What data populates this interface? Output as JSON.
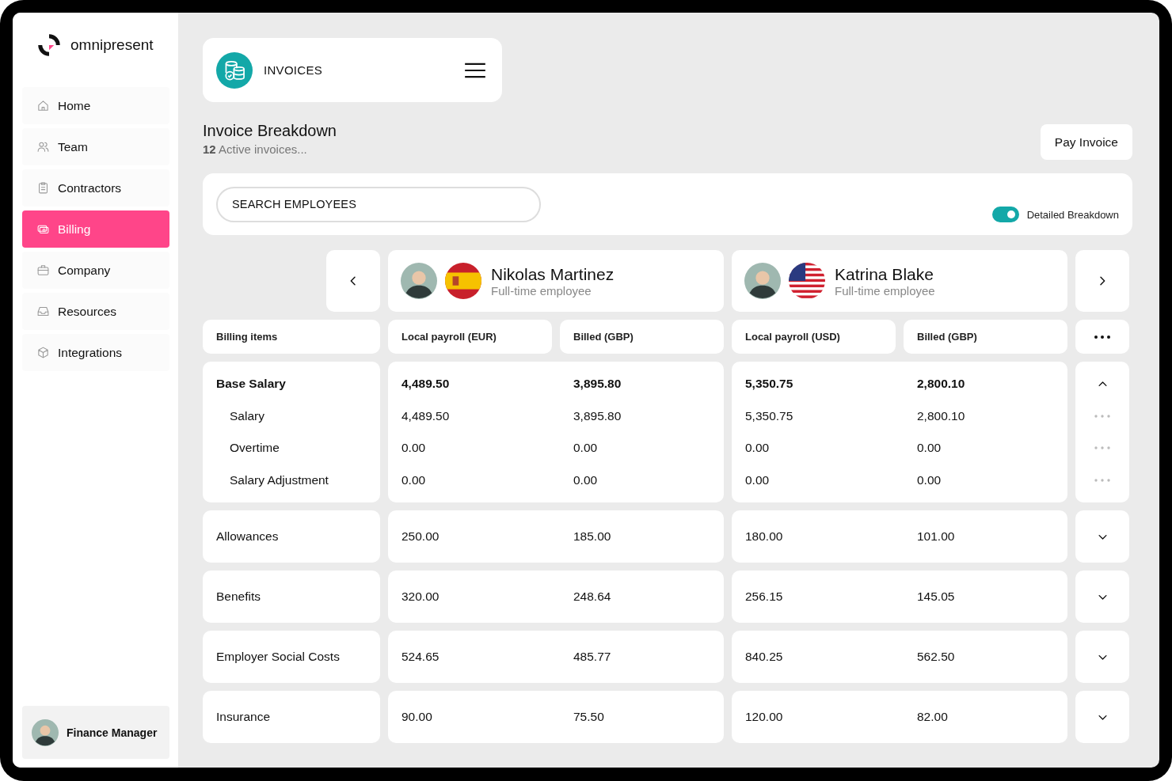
{
  "brand": {
    "name": "omnipresent"
  },
  "nav": {
    "items": [
      {
        "label": "Home",
        "selected": false
      },
      {
        "label": "Team",
        "selected": false
      },
      {
        "label": "Contractors",
        "selected": false
      },
      {
        "label": "Billing",
        "selected": true
      },
      {
        "label": "Company",
        "selected": false
      },
      {
        "label": "Resources",
        "selected": false
      },
      {
        "label": "Integrations",
        "selected": false
      }
    ]
  },
  "user": {
    "role": "Finance Manager"
  },
  "header": {
    "title": "INVOICES"
  },
  "page": {
    "title": "Invoice Breakdown",
    "subtitle": "**12** Active invoices..."
  },
  "pay_button": "Pay Invoice",
  "search": {
    "placeholder": "SEARCH EMPLOYEES"
  },
  "toggle": {
    "label": "Detailed Breakdown",
    "on": true
  },
  "employees": [
    {
      "name": "Nikolas Martinez",
      "type": "Full-time employee"
    },
    {
      "name": "Katrina Blake",
      "type": "Full-time employee"
    }
  ],
  "columns": [
    "Billing items",
    "Local payroll (EUR)",
    "Billed (GBP)",
    "Local payroll (USD)",
    "Billed (GBP)"
  ],
  "groups": [
    {
      "label": "Base Salary",
      "values": [
        "4,489.50",
        "3,895.80",
        "5,350.75",
        "2,800.10"
      ],
      "expanded": true,
      "children": [
        {
          "label": "Salary",
          "values": [
            "4,489.50",
            "3,895.80",
            "5,350.75",
            "2,800.10"
          ]
        },
        {
          "label": "Overtime",
          "values": [
            "0.00",
            "0.00",
            "0.00",
            "0.00"
          ]
        },
        {
          "label": "Salary Adjustment",
          "values": [
            "0.00",
            "0.00",
            "0.00",
            "0.00"
          ]
        }
      ]
    },
    {
      "label": "Allowances",
      "values": [
        "250.00",
        "185.00",
        "180.00",
        "101.00"
      ],
      "expanded": false
    },
    {
      "label": "Benefits",
      "values": [
        "320.00",
        "248.64",
        "256.15",
        "145.05"
      ],
      "expanded": false
    },
    {
      "label": "Employer Social Costs",
      "values": [
        "524.65",
        "485.77",
        "840.25",
        "562.50"
      ],
      "expanded": false
    },
    {
      "label": "Insurance",
      "values": [
        "90.00",
        "75.50",
        "120.00",
        "82.00"
      ],
      "expanded": false
    }
  ]
}
